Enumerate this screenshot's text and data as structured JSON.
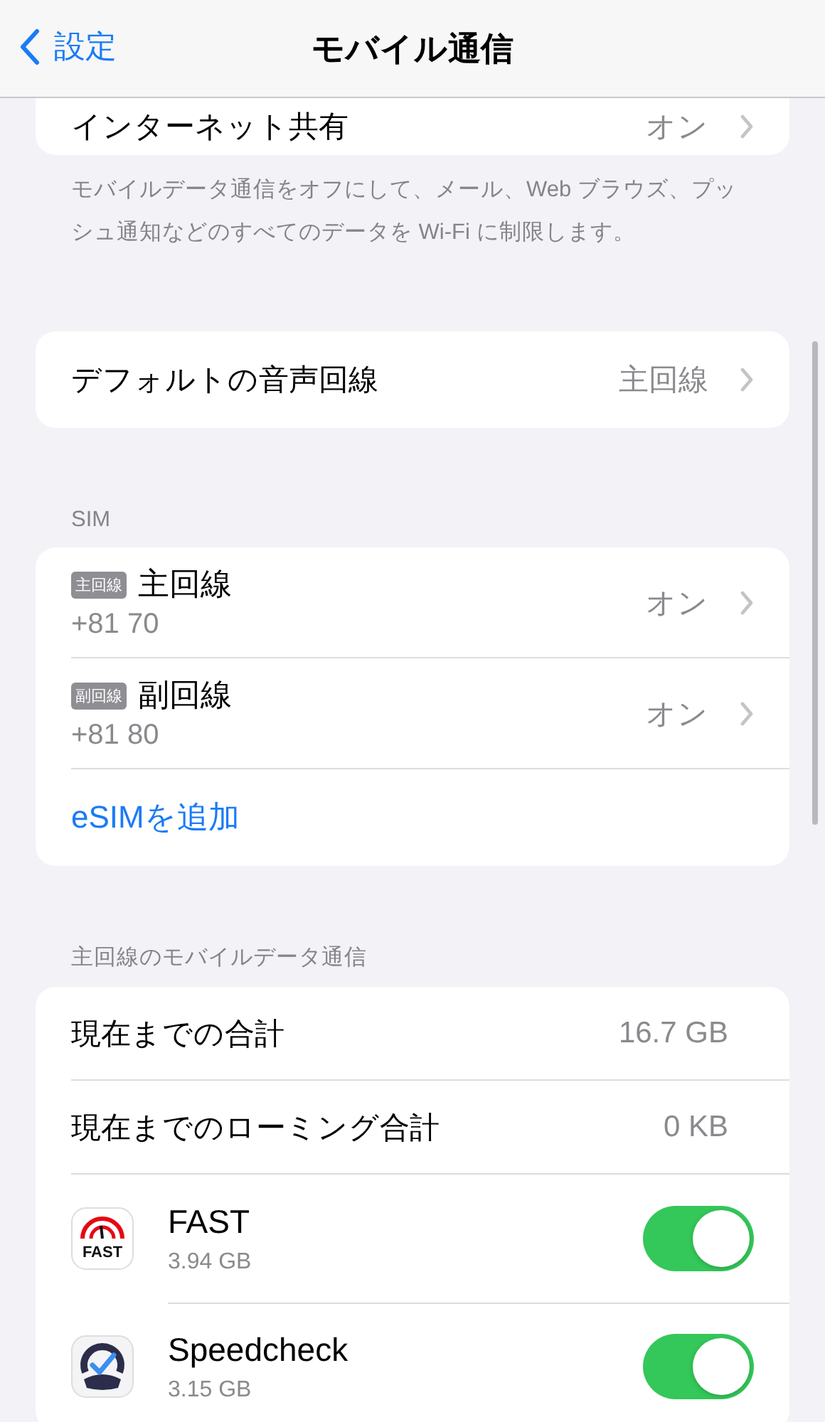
{
  "nav": {
    "back": "設定",
    "title": "モバイル通信"
  },
  "top_group": {
    "rows": [
      {
        "label": "インターネット共有",
        "value": "オン"
      }
    ],
    "footer": "モバイルデータ通信をオフにして、メール、Web ブラウズ、プッシュ通知などのすべてのデータを Wi-Fi に制限します。"
  },
  "voice_group": {
    "rows": [
      {
        "label": "デフォルトの音声回線",
        "value": "主回線"
      }
    ]
  },
  "sim_group": {
    "header": "SIM",
    "lines": [
      {
        "badge": "主回線",
        "name": "主回線",
        "number": "+81 70",
        "value": "オン"
      },
      {
        "badge": "副回線",
        "name": "副回線",
        "number": "+81 80",
        "value": "オン"
      }
    ],
    "add_link": "eSIMを追加"
  },
  "data_group": {
    "header": "主回線のモバイルデータ通信",
    "rows": [
      {
        "kind": "stat",
        "label": "現在までの合計",
        "value": "16.7 GB"
      },
      {
        "kind": "stat",
        "label": "現在までのローミング合計",
        "value": "0 KB"
      },
      {
        "kind": "app",
        "icon_text": "FAST",
        "label": "FAST",
        "usage": "3.94 GB",
        "on": true
      },
      {
        "kind": "app",
        "label": "Speedcheck",
        "usage": "3.15 GB",
        "on": true
      }
    ]
  }
}
